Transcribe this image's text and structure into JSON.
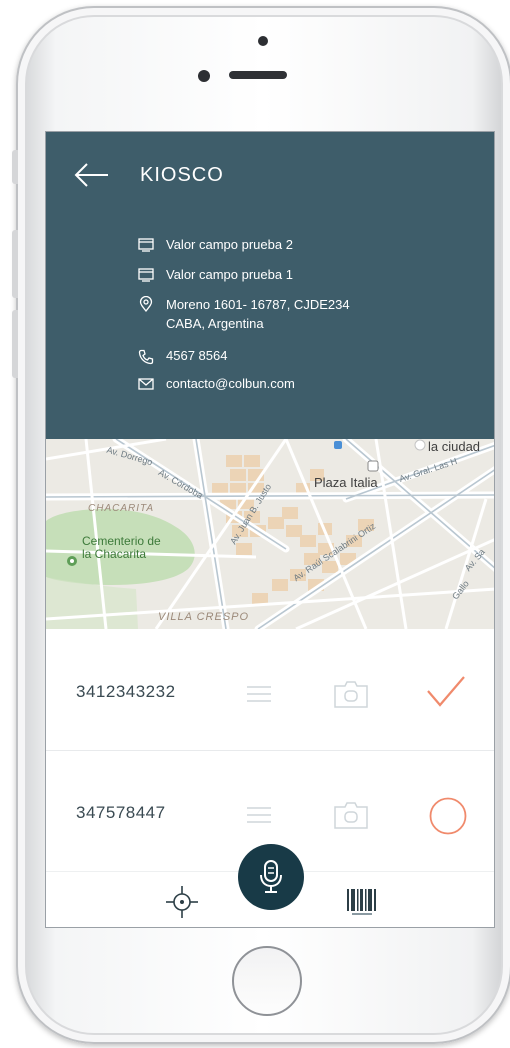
{
  "header": {
    "title": "KIOSCO",
    "back_icon": "arrow-left-icon",
    "field_1": "Valor campo prueba 2",
    "field_2": "Valor campo prueba 1",
    "address_line1": "Moreno 1601- 16787, CJDE234",
    "address_line2": "CABA, Argentina",
    "phone": "4567 8564",
    "email": "contacto@colbun.com",
    "background_color": "#3e5d6a"
  },
  "map": {
    "labels": {
      "plaza_italia": "Plaza Italia",
      "la_ciudad": "la ciudad",
      "chacarita": "CHACARITA",
      "cementerio_line1": "Cementerio de",
      "cementerio_line2": "la Chacarita",
      "villa_crespo": "VILLA CRESPO",
      "av_cordoba": "Av. Córdoba",
      "av_juan_b_justo": "Av. Juan B. Justo",
      "av_raul_scalabrini_ortiz": "Av. Raúl Scalabrini Ortiz",
      "av_gral_las_heras": "Av. Gral. Las H",
      "av_sa": "Av. Sa",
      "gallo": "Gallo",
      "av_dorrego": "Av. Dorrego"
    }
  },
  "list": {
    "items": [
      {
        "code": "3412343232",
        "status": "checked",
        "status_icon": "check-icon"
      },
      {
        "code": "347578447",
        "status": "pending",
        "status_icon": "circle-icon"
      }
    ],
    "accent_color": "#f08a6c"
  },
  "bottom_bar": {
    "left_icon": "crosshair-icon",
    "center_icon": "microphone-icon",
    "right_icon": "barcode-icon",
    "center_color": "#183a47"
  }
}
